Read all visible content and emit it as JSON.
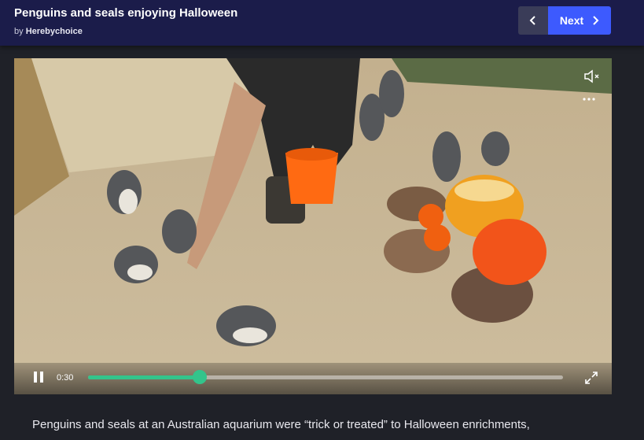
{
  "header": {
    "title": "Penguins and seals enjoying Halloween",
    "byline_prefix": "by",
    "author": "Herebychoice",
    "next_label": "Next",
    "prev_icon": "chevron-left-icon",
    "next_icon": "chevron-right-icon",
    "background_color": "#1b1c4a",
    "accent_color": "#3d5afe"
  },
  "player": {
    "current_time": "0:30",
    "progress_fraction": 0.235,
    "progress_color": "#33c48b",
    "icons": [
      "pause-icon",
      "mute-icon",
      "more-options-icon",
      "fullscreen-icon"
    ]
  },
  "description": {
    "text": "Penguins and seals at an Australian aquarium were “trick or treated” to Halloween enrichments,"
  }
}
